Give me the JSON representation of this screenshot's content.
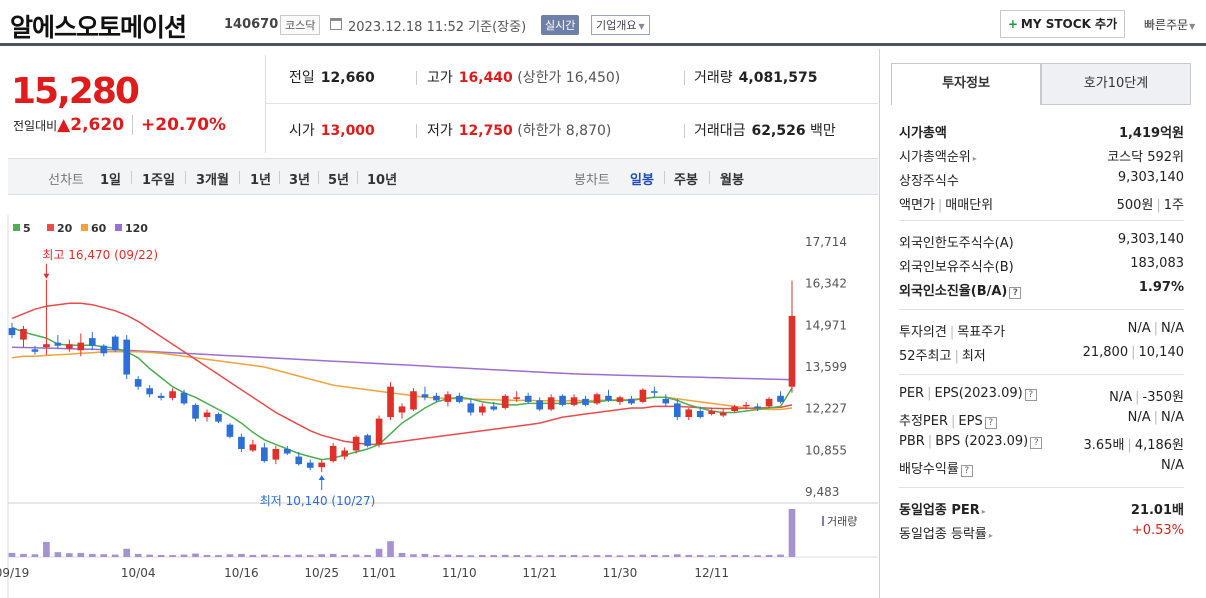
{
  "header": {
    "name": "알에스오토메이션",
    "code": "140670",
    "market": "코스닥",
    "datetime": "2023.12.18 11:52",
    "basis": "기준(장중)",
    "realtime": "실시간",
    "company_info": "기업개요",
    "mystock": "MY STOCK 추가",
    "quick_order": "빠른주문"
  },
  "price": {
    "current": "15,280",
    "diff_label": "전일대비",
    "diff": "▲2,620",
    "pct": "+20.70%"
  },
  "quote": {
    "prev_label": "전일",
    "prev": "12,660",
    "high_label": "고가",
    "high": "16,440",
    "upper_limit": "(상한가 16,450)",
    "volume_label": "거래량",
    "volume": "4,081,575",
    "open_label": "시가",
    "open": "13,000",
    "low_label": "저가",
    "low": "12,750",
    "lower_limit": "(하한가 8,870)",
    "amount_label": "거래대금",
    "amount": "62,526",
    "amount_unit": "백만"
  },
  "period_bar": {
    "line_label": "선차트",
    "line_periods": [
      "1일",
      "1주일",
      "3개월",
      "1년",
      "3년",
      "5년",
      "10년"
    ],
    "candle_label": "봉차트",
    "candle_periods": [
      "일봉",
      "주봉",
      "월봉"
    ],
    "selected_candle": "일봉"
  },
  "chart_data": {
    "type": "candlestick",
    "legend": [
      {
        "name": "5",
        "color": "#4caf50"
      },
      {
        "name": "20",
        "color": "#e84c4c"
      },
      {
        "name": "60",
        "color": "#f0a33a"
      },
      {
        "name": "120",
        "color": "#9b6fd1"
      }
    ],
    "y_ticks": [
      "17,714",
      "16,342",
      "14,971",
      "13,599",
      "12,227",
      "10,855",
      "9,483"
    ],
    "ylim": [
      9483,
      17714
    ],
    "x_ticks": [
      "09/19",
      "10/04",
      "10/16",
      "10/25",
      "11/01",
      "11/10",
      "11/21",
      "11/30",
      "12/11"
    ],
    "x_tick_index": [
      0,
      11,
      20,
      27,
      32,
      39,
      46,
      53,
      61
    ],
    "max_annotation": "최고 16,470 (09/22)",
    "max_index": 3,
    "max_value": 16470,
    "min_annotation": "최저 10,140 (10/27)",
    "min_index": 27,
    "min_value": 10140,
    "volume_label": "거래량",
    "ohlc": [
      [
        14880,
        15050,
        14550,
        14650
      ],
      [
        14500,
        14950,
        14250,
        14850
      ],
      [
        14180,
        14300,
        14000,
        14100
      ],
      [
        14250,
        16470,
        14000,
        14350
      ],
      [
        14400,
        14650,
        14200,
        14300
      ],
      [
        14200,
        14500,
        14100,
        14350
      ],
      [
        14150,
        14700,
        13950,
        14400
      ],
      [
        14550,
        14750,
        14150,
        14300
      ],
      [
        14300,
        14350,
        13950,
        14050
      ],
      [
        14600,
        14650,
        14100,
        14150
      ],
      [
        14500,
        14650,
        13200,
        13350
      ],
      [
        13200,
        13300,
        12850,
        12950
      ],
      [
        12900,
        13000,
        12600,
        12700
      ],
      [
        12650,
        12750,
        12500,
        12580
      ],
      [
        12580,
        12900,
        12500,
        12800
      ],
      [
        12750,
        12850,
        12350,
        12400
      ],
      [
        12350,
        12400,
        11800,
        11900
      ],
      [
        11950,
        12200,
        11800,
        12100
      ],
      [
        12050,
        12100,
        11750,
        11800
      ],
      [
        11700,
        11750,
        11250,
        11300
      ],
      [
        11300,
        11400,
        10800,
        10900
      ],
      [
        10850,
        11200,
        10800,
        11050
      ],
      [
        10950,
        11100,
        10450,
        10500
      ],
      [
        10550,
        11000,
        10400,
        10900
      ],
      [
        10900,
        11000,
        10700,
        10750
      ],
      [
        10650,
        10800,
        10350,
        10400
      ],
      [
        10450,
        10550,
        10200,
        10280
      ],
      [
        10300,
        10550,
        10140,
        10450
      ],
      [
        10500,
        11100,
        10450,
        11000
      ],
      [
        10650,
        10950,
        10550,
        10850
      ],
      [
        10850,
        11350,
        10750,
        11300
      ],
      [
        11350,
        11400,
        10950,
        11000
      ],
      [
        11050,
        12000,
        10950,
        11900
      ],
      [
        11950,
        13100,
        11850,
        12950
      ],
      [
        12100,
        12400,
        11900,
        12300
      ],
      [
        12200,
        12900,
        12150,
        12800
      ],
      [
        12700,
        12950,
        12500,
        12600
      ],
      [
        12650,
        12750,
        12450,
        12500
      ],
      [
        12450,
        12800,
        12300,
        12700
      ],
      [
        12650,
        12750,
        12400,
        12450
      ],
      [
        12400,
        12550,
        12000,
        12100
      ],
      [
        12100,
        12400,
        12000,
        12300
      ],
      [
        12300,
        12450,
        12150,
        12200
      ],
      [
        12250,
        12700,
        12200,
        12650
      ],
      [
        12550,
        12800,
        12450,
        12600
      ],
      [
        12650,
        12750,
        12400,
        12450
      ],
      [
        12500,
        12600,
        12150,
        12200
      ],
      [
        12200,
        12700,
        12150,
        12600
      ],
      [
        12650,
        12700,
        12300,
        12350
      ],
      [
        12350,
        12700,
        12300,
        12600
      ],
      [
        12550,
        12650,
        12300,
        12350
      ],
      [
        12400,
        12750,
        12350,
        12700
      ],
      [
        12650,
        12850,
        12450,
        12500
      ],
      [
        12450,
        12650,
        12350,
        12600
      ],
      [
        12550,
        12650,
        12350,
        12400
      ],
      [
        12450,
        12900,
        12400,
        12850
      ],
      [
        12800,
        12950,
        12600,
        12750
      ],
      [
        12550,
        12700,
        12300,
        12400
      ],
      [
        12400,
        12550,
        11850,
        11950
      ],
      [
        11950,
        12250,
        11850,
        12200
      ],
      [
        12150,
        12300,
        11900,
        11950
      ],
      [
        12050,
        12250,
        12000,
        12150
      ],
      [
        12000,
        12200,
        11950,
        12100
      ],
      [
        12150,
        12350,
        12100,
        12300
      ],
      [
        12300,
        12450,
        12200,
        12350
      ],
      [
        12300,
        12400,
        12150,
        12250
      ],
      [
        12300,
        12600,
        12250,
        12550
      ],
      [
        12650,
        12800,
        12400,
        12450
      ],
      [
        12950,
        16440,
        12750,
        15280
      ]
    ],
    "ma5": [
      14900,
      14750,
      14650,
      14550,
      14350,
      14320,
      14310,
      14320,
      14260,
      14220,
      14100,
      13900,
      13550,
      13250,
      12950,
      12750,
      12600,
      12400,
      12200,
      12000,
      11750,
      11450,
      11200,
      11050,
      10900,
      10750,
      10650,
      10550,
      10600,
      10700,
      10800,
      10900,
      11050,
      11400,
      11750,
      12000,
      12250,
      12450,
      12550,
      12600,
      12550,
      12450,
      12400,
      12350,
      12350,
      12400,
      12400,
      12400,
      12400,
      12400,
      12450,
      12450,
      12500,
      12500,
      12500,
      12550,
      12600,
      12600,
      12500,
      12350,
      12250,
      12150,
      12100,
      12100,
      12150,
      12200,
      12250,
      12300,
      12900
    ],
    "ma20": [
      15200,
      15350,
      15500,
      15600,
      15650,
      15700,
      15700,
      15650,
      15550,
      15450,
      15300,
      15100,
      14850,
      14600,
      14350,
      14100,
      13850,
      13600,
      13350,
      13100,
      12850,
      12600,
      12350,
      12100,
      11900,
      11700,
      11500,
      11350,
      11250,
      11150,
      11100,
      11050,
      11050,
      11100,
      11150,
      11200,
      11250,
      11300,
      11350,
      11400,
      11450,
      11500,
      11550,
      11600,
      11650,
      11700,
      11750,
      11850,
      11950,
      12000,
      12050,
      12100,
      12150,
      12200,
      12250,
      12250,
      12300,
      12300,
      12300,
      12280,
      12260,
      12240,
      12230,
      12230,
      12240,
      12250,
      12260,
      12270,
      12350
    ],
    "ma60": [
      13900,
      13950,
      13950,
      13980,
      14000,
      14020,
      14050,
      14070,
      14100,
      14100,
      14100,
      14100,
      14080,
      14050,
      14000,
      13950,
      13900,
      13850,
      13800,
      13750,
      13700,
      13650,
      13600,
      13500,
      13400,
      13300,
      13200,
      13100,
      13000,
      12950,
      12900,
      12850,
      12800,
      12750,
      12700,
      12650,
      12600,
      12580,
      12560,
      12550,
      12540,
      12530,
      12520,
      12510,
      12500,
      12500,
      12490,
      12490,
      12490,
      12490,
      12490,
      12500,
      12510,
      12520,
      12530,
      12560,
      12600,
      12600,
      12550,
      12500,
      12450,
      12400,
      12350,
      12300,
      12250,
      12220,
      12200,
      12200,
      12250
    ],
    "ma120": [
      14250,
      14240,
      14230,
      14220,
      14210,
      14200,
      14190,
      14180,
      14170,
      14160,
      14150,
      14130,
      14110,
      14090,
      14070,
      14050,
      14030,
      14010,
      13990,
      13970,
      13950,
      13930,
      13910,
      13890,
      13870,
      13850,
      13830,
      13810,
      13790,
      13770,
      13750,
      13730,
      13710,
      13690,
      13670,
      13650,
      13630,
      13610,
      13590,
      13570,
      13550,
      13530,
      13510,
      13490,
      13470,
      13450,
      13430,
      13410,
      13390,
      13370,
      13360,
      13350,
      13340,
      13330,
      13320,
      13310,
      13300,
      13290,
      13280,
      13270,
      13260,
      13250,
      13240,
      13230,
      13220,
      13210,
      13200,
      13190,
      13180
    ],
    "volume": [
      60,
      45,
      40,
      220,
      70,
      55,
      60,
      45,
      40,
      35,
      120,
      45,
      35,
      30,
      28,
      35,
      50,
      30,
      28,
      40,
      45,
      30,
      35,
      28,
      30,
      35,
      28,
      40,
      45,
      30,
      35,
      30,
      120,
      230,
      60,
      40,
      45,
      30,
      35,
      30,
      25,
      30,
      28,
      32,
      30,
      28,
      25,
      30,
      28,
      30,
      25,
      28,
      30,
      25,
      28,
      35,
      30,
      28,
      40,
      30,
      28,
      25,
      28,
      30,
      28,
      25,
      30,
      35,
      700
    ]
  },
  "right_panel": {
    "tab_active": "투자정보",
    "tab_other": "호가10단계",
    "rows1": [
      {
        "l": "시가총액",
        "r": "1,419억원",
        "bold": true
      },
      {
        "l": "시가총액순위",
        "r": "코스닥 592위",
        "arrow": true
      },
      {
        "l": "상장주식수",
        "r": "9,303,140"
      },
      {
        "l": "액면가 | 매매단위",
        "r": "500원 | 1주"
      }
    ],
    "rows2": [
      {
        "l": "외국인한도주식수(A)",
        "r": "9,303,140"
      },
      {
        "l": "외국인보유주식수(B)",
        "r": "183,083"
      },
      {
        "l": "외국인소진율(B/A)",
        "r": "1.97%",
        "bold": true,
        "help": true
      }
    ],
    "rows3": [
      {
        "l": "투자의견 | 목표주가",
        "r": "N/A | N/A"
      },
      {
        "l": "52주최고 | 최저",
        "r": "21,800 | 10,140"
      }
    ],
    "rows4": [
      {
        "l": "PER | EPS(2023.09)",
        "r": "N/A | -350원",
        "help": true
      },
      {
        "l": "추정PER | EPS",
        "r": "N/A | N/A",
        "help": true
      },
      {
        "l": "PBR | BPS (2023.09)",
        "r": "3.65배 | 4,186원",
        "help": true
      },
      {
        "l": "배당수익률",
        "r": "N/A",
        "help": true
      }
    ],
    "rows5": [
      {
        "l": "동일업종 PER",
        "r": "21.01배",
        "bold": true,
        "arrow": true
      },
      {
        "l": "동일업종 등락률",
        "r": "+0.53%",
        "red": true,
        "arrow": true
      }
    ]
  }
}
